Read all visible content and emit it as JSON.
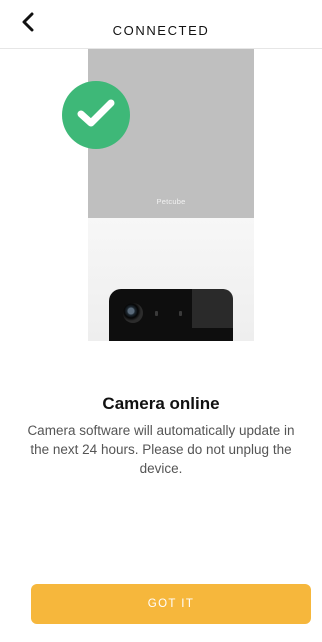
{
  "header": {
    "title": "CONNECTED",
    "back_icon": "chevron-left-icon"
  },
  "illustration": {
    "brand_text": "Petcube",
    "status_icon": "checkmark-icon",
    "status_color": "#3eb878"
  },
  "content": {
    "headline": "Camera online",
    "message": "Camera software will automatically update in the next 24 hours. Please do not unplug the device."
  },
  "actions": {
    "primary_label": "GOT IT",
    "primary_color": "#f6b73c"
  }
}
